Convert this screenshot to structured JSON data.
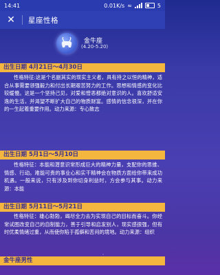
{
  "status_bar": {
    "time": "14:41",
    "speed": "0.01K/s",
    "battery": "5"
  },
  "app_bar": {
    "close_icon": "close-icon",
    "title": "星座性格"
  },
  "header": {
    "emblem_icon": "taurus-icon",
    "sign_name": "金牛座",
    "date_range": "(4.20-5.20)"
  },
  "sections": [
    {
      "heading": "出生日期 4月21日～4月30日",
      "text": "性格特征:这是个名副其实的现实主义者，具有持之以恒的精神，适合从事需要领强毅力和付出长期艰苦努力的工作。思想和情感的变化比较缓慢。这是一个坚持己见，对爱和憎恶都绝对意识的人。喜欢舒适安逸的生活，并渴望不断扩大自己的物质财富。感情的信念很深，并在你的一生起着重要作用。动力来源：专心致志"
    },
    {
      "heading": "出生日期 5月1日～5月10日",
      "text": "性格特征：本能和潜意识常形成巨大的精神力量，支配你的思维、情感、行动。难能可贵的事业心和实干精神会在物质方面给你带来成功机遇。一般来说，只有涉及到你切身利益时，方会参与其事。动力来源：本能"
    },
    {
      "heading": "出生日期 5月11日～5月21日",
      "text": "性格特征：雄心勃勃，竭尽全力去为实现自己的目标而奋斗。你经常试图改变自己的自制能力，善于引导和启发别人，现实感很强，但有时优柔情绪过重，从而使你陷于孤僻和苦闷的境地。动力来源：组织"
    },
    {
      "heading": "金牛座男性",
      "text": ""
    }
  ]
}
